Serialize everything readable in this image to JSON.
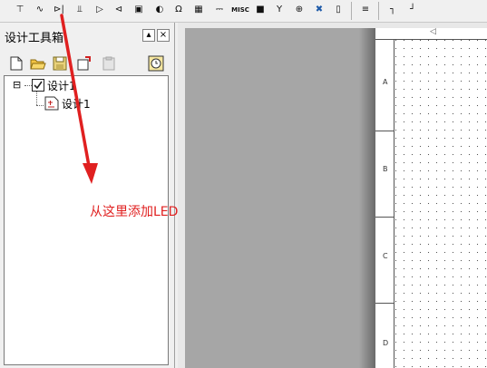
{
  "toolbar": {
    "icons": [
      {
        "name": "ground-icon",
        "glyph": "⊤"
      },
      {
        "name": "resistor-icon",
        "glyph": "∿"
      },
      {
        "name": "diode-icon",
        "glyph": "⊳|"
      },
      {
        "name": "transistor-icon",
        "glyph": "⫫"
      },
      {
        "name": "opamp-icon",
        "glyph": "▷"
      },
      {
        "name": "logic-gate-icon",
        "glyph": "⊲"
      },
      {
        "name": "connector-icon",
        "glyph": "▣"
      },
      {
        "name": "speaker-icon",
        "glyph": "◐"
      },
      {
        "name": "ohm-meter-icon",
        "glyph": "Ω"
      },
      {
        "name": "ic-chip-icon",
        "glyph": "▦"
      },
      {
        "name": "battery-icon",
        "glyph": "⎓"
      },
      {
        "name": "misc-icon",
        "glyph": "MISC"
      },
      {
        "name": "monitor-icon",
        "glyph": "■"
      },
      {
        "name": "antenna-icon",
        "glyph": "Y"
      },
      {
        "name": "motor-icon",
        "glyph": "⊕"
      },
      {
        "name": "tools-icon",
        "glyph": "✖"
      },
      {
        "name": "crystal-icon",
        "glyph": "▯"
      },
      {
        "name": "component-bank-icon",
        "glyph": "≡"
      },
      {
        "name": "wire-icon",
        "glyph": "┐"
      },
      {
        "name": "step-icon",
        "glyph": "┘"
      }
    ]
  },
  "toolbox": {
    "title": "设计工具箱",
    "pin_glyph": "▴",
    "close_glyph": "×"
  },
  "tree": {
    "expander": "⊟",
    "root_label": "设计1",
    "child_label": "设计1"
  },
  "sheet": {
    "zones": [
      "A",
      "B",
      "C",
      "D"
    ]
  },
  "annotation": {
    "text": "从这里添加LED",
    "color": "#e02020"
  }
}
